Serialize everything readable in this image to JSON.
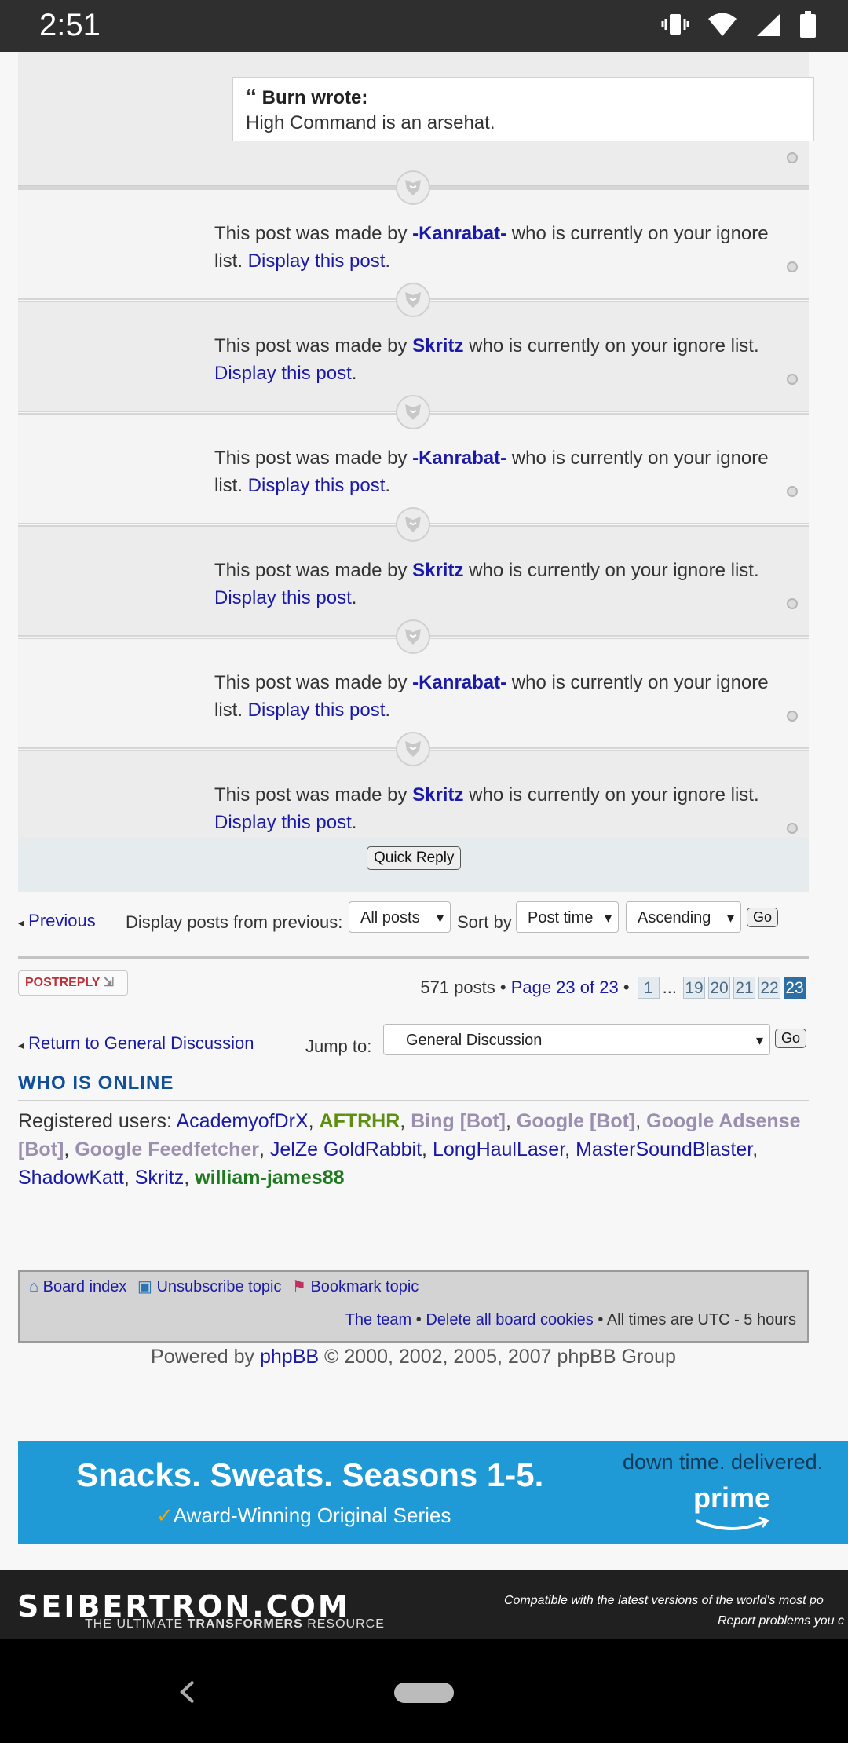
{
  "status_bar": {
    "time": "2:51"
  },
  "quote": {
    "header": "Burn wrote:",
    "text": "High Command is an arsehat."
  },
  "posts": [
    {
      "prefix": "This post was made by ",
      "author": "-Kanrabat-",
      "suffix": " who is currently on your ignore list. ",
      "link": "Display this post",
      "end": "."
    },
    {
      "prefix": "This post was made by ",
      "author": "Skritz",
      "suffix": " who is currently on your ignore list. ",
      "link": "Display this post",
      "end": "."
    },
    {
      "prefix": "This post was made by ",
      "author": "-Kanrabat-",
      "suffix": " who is currently on your ignore list. ",
      "link": "Display this post",
      "end": "."
    },
    {
      "prefix": "This post was made by ",
      "author": "Skritz",
      "suffix": " who is currently on your ignore list. ",
      "link": "Display this post",
      "end": "."
    },
    {
      "prefix": "This post was made by ",
      "author": "-Kanrabat-",
      "suffix": " who is currently on your ignore list. ",
      "link": "Display this post",
      "end": "."
    },
    {
      "prefix": "This post was made by ",
      "author": "Skritz",
      "suffix": " who is currently on your ignore list. ",
      "link": "Display this post",
      "end": "."
    }
  ],
  "quick_reply": "Quick Reply",
  "sort_bar": {
    "previous": "Previous",
    "display_label": "Display posts from previous:",
    "display_value": "All posts",
    "sort_label": "Sort by",
    "sort_value": "Post time",
    "order_value": "Ascending",
    "go": "Go"
  },
  "post_reply": {
    "part1": "POST",
    "part2": "REPLY"
  },
  "pagination": {
    "posts_count": "571 posts",
    "sep": "•",
    "page_text": "Page 23 of 23",
    "pages": [
      "1",
      "...",
      "19",
      "20",
      "21",
      "22",
      "23"
    ]
  },
  "jump": {
    "return_link": "Return to General Discussion",
    "jump_label": "Jump to:",
    "jump_value": "General Discussion",
    "go": "Go"
  },
  "who_is_online": {
    "title": "WHO IS ONLINE",
    "label": "Registered users: ",
    "users": [
      {
        "name": "AcademyofDrX",
        "style": "link"
      },
      {
        "name": "AFTRHR",
        "style": "green"
      },
      {
        "name": "Bing [Bot]",
        "style": "bot"
      },
      {
        "name": "Google [Bot]",
        "style": "bot"
      },
      {
        "name": "Google Adsense [Bot]",
        "style": "bot"
      },
      {
        "name": "Google Feedfetcher",
        "style": "bot"
      },
      {
        "name": "JelZe GoldRabbit",
        "style": "link"
      },
      {
        "name": "LongHaulLaser",
        "style": "link"
      },
      {
        "name": "MasterSoundBlaster",
        "style": "link"
      },
      {
        "name": "ShadowKatt",
        "style": "link"
      },
      {
        "name": "Skritz",
        "style": "link"
      },
      {
        "name": "william-james88",
        "style": "dkgreen"
      }
    ]
  },
  "nav_footer": {
    "board_index": "Board index",
    "unsubscribe": "Unsubscribe topic",
    "bookmark": "Bookmark topic",
    "team": "The team",
    "sep": "•",
    "delete_cookies": "Delete all board cookies",
    "times": "All times are UTC - 5 hours"
  },
  "powered": {
    "prefix": "Powered by ",
    "link": "phpBB",
    "suffix": " © 2000, 2002, 2005, 2007 phpBB Group"
  },
  "ad": {
    "line1": "Snacks. Sweats. Seasons 1-5.",
    "line2": "Award-Winning Original Series",
    "right1": "down time. delivered.",
    "right2": "prime"
  },
  "site_footer": {
    "logo": "SEIBERTRON.COM",
    "tagline_a": "THE ULTIMATE ",
    "tagline_b": "TRANSFORMERS",
    "tagline_c": " RESOURCE",
    "compat": "Compatible with the latest versions of the world's most po",
    "report": "Report problems you c"
  },
  "colors": {
    "link": "#1a1aa6",
    "accent": "#2e6fa3",
    "ad_bg": "#1f9ad6",
    "status_bar": "#2f2f2f"
  }
}
